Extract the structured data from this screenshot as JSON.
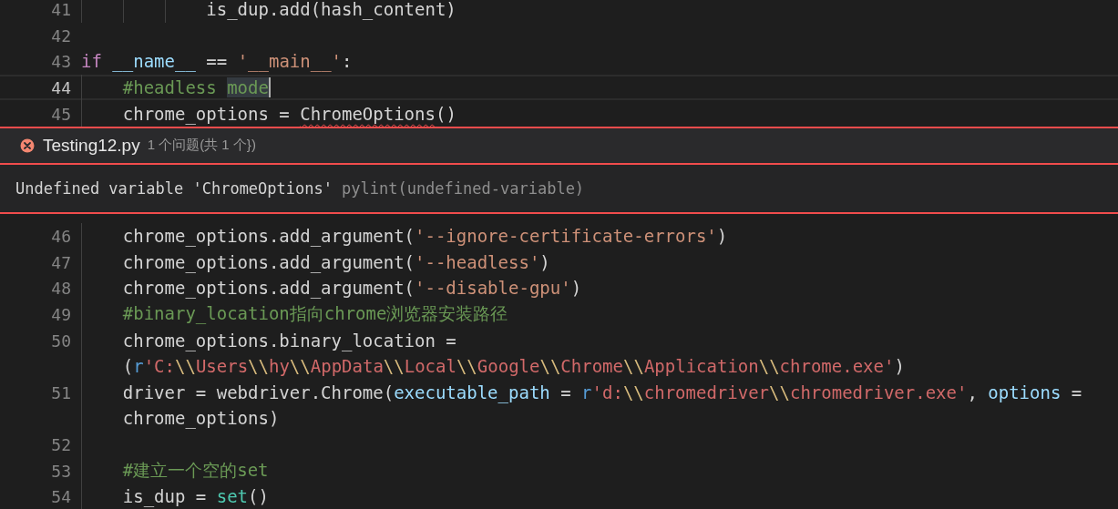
{
  "editor_top": {
    "lines": [
      {
        "number": "41",
        "current": false,
        "rows": [
          [
            {
              "kind": "plain",
              "text": "            is_dup.add(hash_content)"
            }
          ]
        ]
      },
      {
        "number": "42",
        "current": false,
        "rows": [
          []
        ]
      },
      {
        "number": "43",
        "current": false,
        "rows": [
          [
            {
              "kind": "keyword",
              "text": "if"
            },
            {
              "kind": "plain",
              "text": " "
            },
            {
              "kind": "variable",
              "text": "__name__"
            },
            {
              "kind": "plain",
              "text": " == "
            },
            {
              "kind": "string",
              "text": "'__main__'"
            },
            {
              "kind": "plain",
              "text": ":"
            }
          ]
        ]
      },
      {
        "number": "44",
        "current": true,
        "rows": [
          [
            {
              "kind": "comment",
              "text": "    #headless "
            },
            {
              "kind": "comment",
              "text": "mode",
              "highlighted": true,
              "cursor": true
            }
          ]
        ]
      },
      {
        "number": "45",
        "current": false,
        "rows": [
          [
            {
              "kind": "plain",
              "text": "    chrome_options = "
            },
            {
              "kind": "plain",
              "text": "ChromeOptions",
              "error": true
            },
            {
              "kind": "plain",
              "text": "()"
            }
          ]
        ]
      }
    ]
  },
  "peek": {
    "file": "Testing12.py",
    "count": "1 个问题(共 1 个})",
    "message": "Undefined variable 'ChromeOptions'",
    "source": "pylint(undefined-variable)"
  },
  "editor_bottom": {
    "lines": [
      {
        "number": "46",
        "current": false,
        "rows": [
          [
            {
              "kind": "plain",
              "text": "    chrome_options.add_argument("
            },
            {
              "kind": "string",
              "text": "'--ignore-certificate-errors'"
            },
            {
              "kind": "plain",
              "text": ")"
            }
          ]
        ]
      },
      {
        "number": "47",
        "current": false,
        "rows": [
          [
            {
              "kind": "plain",
              "text": "    chrome_options.add_argument("
            },
            {
              "kind": "string",
              "text": "'--headless'"
            },
            {
              "kind": "plain",
              "text": ")"
            }
          ]
        ]
      },
      {
        "number": "48",
        "current": false,
        "rows": [
          [
            {
              "kind": "plain",
              "text": "    chrome_options.add_argument("
            },
            {
              "kind": "string",
              "text": "'--disable-gpu'"
            },
            {
              "kind": "plain",
              "text": ")"
            }
          ]
        ]
      },
      {
        "number": "49",
        "current": false,
        "rows": [
          [
            {
              "kind": "comment",
              "text": "    #binary_location指向chrome浏览器安装路径"
            }
          ]
        ]
      },
      {
        "number": "50",
        "current": false,
        "rows": [
          [
            {
              "kind": "plain",
              "text": "    chrome_options.binary_location ="
            }
          ],
          [
            {
              "kind": "plain",
              "text": "    ("
            },
            {
              "kind": "storage",
              "text": "r"
            },
            {
              "kind": "rstring",
              "text": "'C:"
            },
            {
              "kind": "escape",
              "text": "\\\\"
            },
            {
              "kind": "rstring",
              "text": "Users"
            },
            {
              "kind": "escape",
              "text": "\\\\"
            },
            {
              "kind": "rstring",
              "text": "hy"
            },
            {
              "kind": "escape",
              "text": "\\\\"
            },
            {
              "kind": "rstring",
              "text": "AppData"
            },
            {
              "kind": "escape",
              "text": "\\\\"
            },
            {
              "kind": "rstring",
              "text": "Local"
            },
            {
              "kind": "escape",
              "text": "\\\\"
            },
            {
              "kind": "rstring",
              "text": "Google"
            },
            {
              "kind": "escape",
              "text": "\\\\"
            },
            {
              "kind": "rstring",
              "text": "Chrome"
            },
            {
              "kind": "escape",
              "text": "\\\\"
            },
            {
              "kind": "rstring",
              "text": "Application"
            },
            {
              "kind": "escape",
              "text": "\\\\"
            },
            {
              "kind": "rstring",
              "text": "chrome.exe'"
            },
            {
              "kind": "plain",
              "text": ")"
            }
          ]
        ]
      },
      {
        "number": "51",
        "current": false,
        "rows": [
          [
            {
              "kind": "plain",
              "text": "    driver = webdriver.Chrome("
            },
            {
              "kind": "variable",
              "text": "executable_path"
            },
            {
              "kind": "plain",
              "text": " = "
            },
            {
              "kind": "storage",
              "text": "r"
            },
            {
              "kind": "rstring",
              "text": "'d:"
            },
            {
              "kind": "escape",
              "text": "\\\\"
            },
            {
              "kind": "rstring",
              "text": "chromedriver"
            },
            {
              "kind": "escape",
              "text": "\\\\"
            },
            {
              "kind": "rstring",
              "text": "chromedriver.exe'"
            },
            {
              "kind": "plain",
              "text": ", "
            },
            {
              "kind": "variable",
              "text": "options"
            },
            {
              "kind": "plain",
              "text": " ="
            }
          ],
          [
            {
              "kind": "plain",
              "text": "    chrome_options)"
            }
          ]
        ]
      },
      {
        "number": "52",
        "current": false,
        "rows": [
          []
        ]
      },
      {
        "number": "53",
        "current": false,
        "rows": [
          [
            {
              "kind": "comment",
              "text": "    #建立一个空的set"
            }
          ]
        ]
      },
      {
        "number": "54",
        "current": false,
        "rows": [
          [
            {
              "kind": "plain",
              "text": "    is_dup = "
            },
            {
              "kind": "builtin",
              "text": "set"
            },
            {
              "kind": "plain",
              "text": "()"
            }
          ]
        ]
      }
    ]
  }
}
